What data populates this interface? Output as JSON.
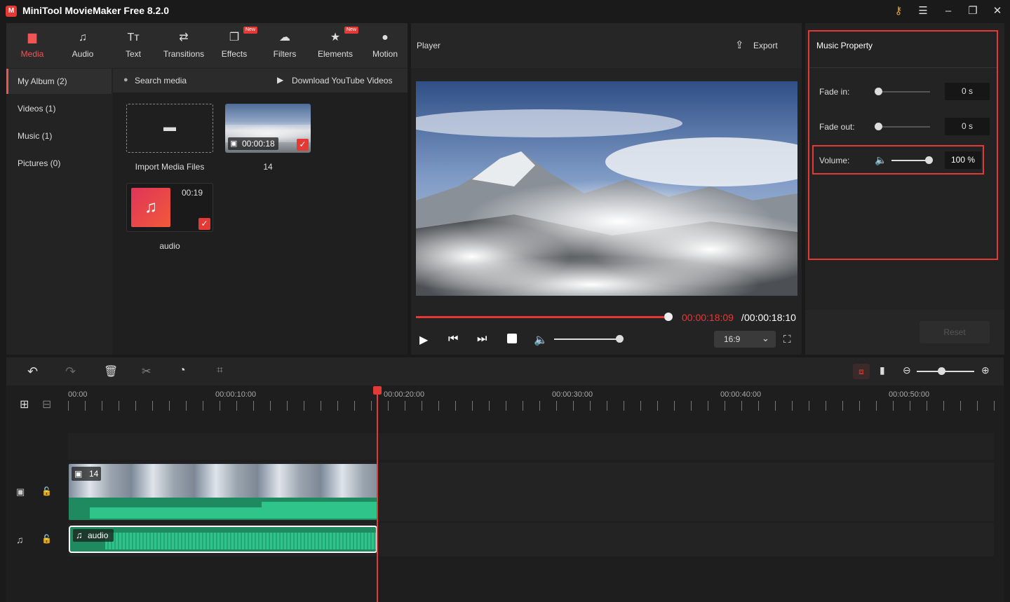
{
  "titlebar": {
    "title": "MiniTool MovieMaker Free 8.2.0",
    "logo": "M"
  },
  "toolbar": {
    "tabs": [
      {
        "label": "Media",
        "icon": "media-icon",
        "active": true
      },
      {
        "label": "Audio",
        "icon": "audio-icon"
      },
      {
        "label": "Text",
        "icon": "text-icon"
      },
      {
        "label": "Transitions",
        "icon": "transitions-icon"
      },
      {
        "label": "Effects",
        "icon": "effects-icon",
        "badge": "New"
      },
      {
        "label": "Filters",
        "icon": "filters-icon"
      },
      {
        "label": "Elements",
        "icon": "elements-icon",
        "badge": "New"
      },
      {
        "label": "Motion",
        "icon": "motion-icon"
      }
    ]
  },
  "album": {
    "items": [
      "My Album (2)",
      "Videos (1)",
      "Music (1)",
      "Pictures (0)"
    ]
  },
  "media": {
    "search_placeholder": "Search media",
    "download_label": "Download YouTube Videos",
    "import_label": "Import Media Files",
    "video_duration": "00:00:18",
    "video_name": "14",
    "audio_duration": "00:19",
    "audio_name": "audio"
  },
  "player": {
    "title": "Player",
    "export_label": "Export",
    "current_time": "00:00:18:09",
    "separator": " / ",
    "total_time": "00:00:18:10",
    "aspect": "16:9",
    "progress": 0.99,
    "volume": 0.82
  },
  "property": {
    "title": "Music Property",
    "fade_in_label": "Fade in:",
    "fade_in_value": "0 s",
    "fade_out_label": "Fade out:",
    "fade_out_value": "0 s",
    "volume_label": "Volume:",
    "volume_value": "100 %",
    "reset_label": "Reset"
  },
  "timeline": {
    "ticks": [
      "00:00",
      "00:00:10:00",
      "00:00:20:00",
      "00:00:30:00",
      "00:00:40:00",
      "00:00:50:00"
    ],
    "video_clip_label": "14",
    "audio_clip_label": "audio"
  },
  "colors": {
    "accent": "#e53935",
    "audio_wave": "#2ec48a"
  }
}
